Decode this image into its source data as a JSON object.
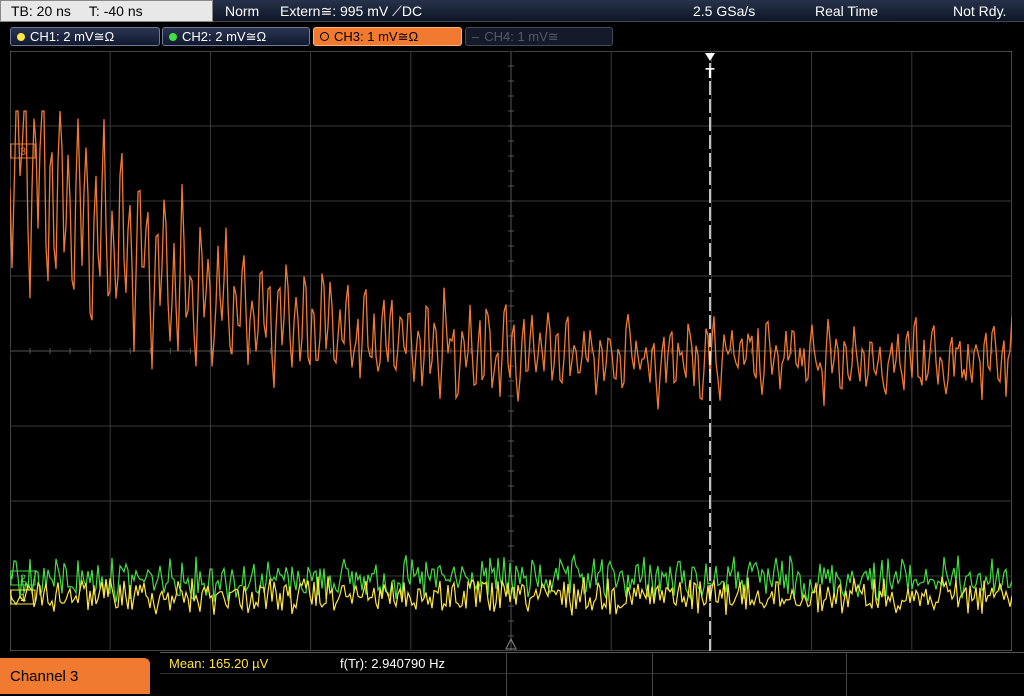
{
  "timebase": {
    "tb": "TB: 20 ns",
    "trigger_pos": "T: -40 ns"
  },
  "status": {
    "mode": "Norm",
    "trigger": "Extern≅: 995 mV ⟋DC",
    "sample_rate": "2.5 GSa/s",
    "acq": "Real Time",
    "state": "Not Rdy."
  },
  "channels": [
    {
      "label": "CH1: 2 mV≅Ω",
      "color": "#ffe640",
      "state": "on"
    },
    {
      "label": "CH2: 2 mV≅Ω",
      "color": "#44dd44",
      "state": "on"
    },
    {
      "label": "CH3: 1 mV≅Ω",
      "color": "#f07a30",
      "state": "active"
    },
    {
      "label": "CH4: 1 mV≅",
      "color": "#555a66",
      "state": "off"
    }
  ],
  "trigger_marker": "T",
  "channel_markers": {
    "ch3": "3",
    "ch2": "2",
    "ch1": "1"
  },
  "bottom": {
    "active_channel": "Channel 3",
    "measurements": [
      {
        "label": "Mean:",
        "value": "165.20 µV",
        "color": "#ffe640"
      },
      {
        "label": "f(Tr):",
        "value": "2.940790 Hz",
        "color": "#ffffff"
      }
    ]
  },
  "colors": {
    "ch1": "#ffe640",
    "ch2": "#44dd44",
    "ch3": "#f07a30",
    "grid": "#3a3a3a",
    "background": "#000000"
  }
}
